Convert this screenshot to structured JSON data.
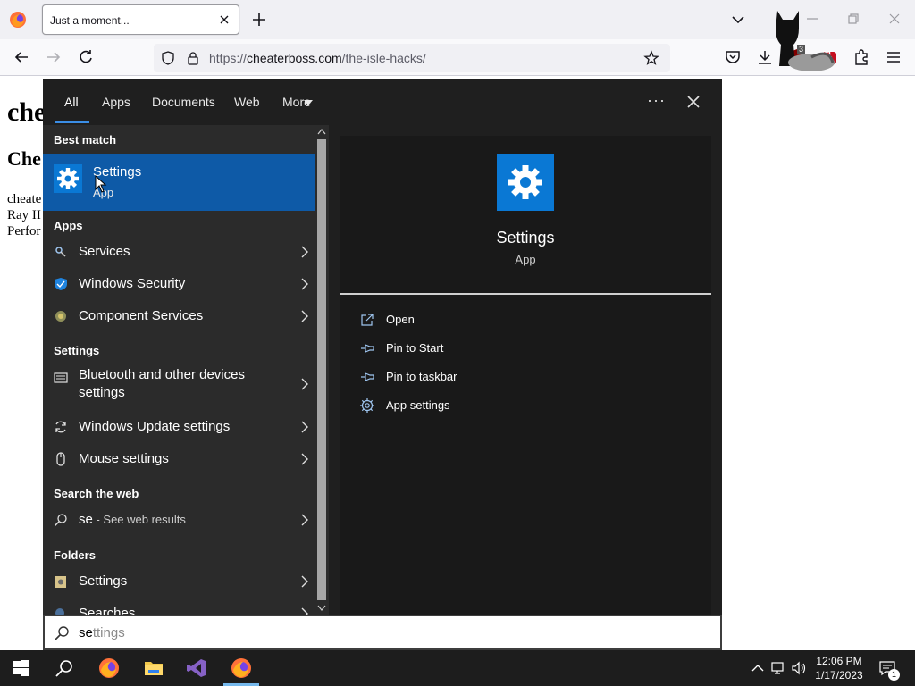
{
  "browser": {
    "tab_title": "Just a moment...",
    "url_prefix": "https://",
    "url_domain": "cheaterboss.com",
    "url_path": "/the-isle-hacks/",
    "ublock_count": "3",
    "ext_badge": "91"
  },
  "page": {
    "heading1": "che",
    "heading2": "Che",
    "line1": "cheate",
    "line2": "Ray II",
    "line3": "Perfor"
  },
  "search": {
    "filters": [
      "All",
      "Apps",
      "Documents",
      "Web",
      "More"
    ],
    "more_menu_icon": "ellipsis-icon",
    "sections": {
      "best_match": "Best match",
      "apps": "Apps",
      "settings": "Settings",
      "search_web": "Search the web",
      "folders": "Folders"
    },
    "best_match": {
      "title": "Settings",
      "subtitle": "App"
    },
    "apps": [
      {
        "label": "Services"
      },
      {
        "label": "Windows Security"
      },
      {
        "label": "Component Services"
      }
    ],
    "settings_results": [
      {
        "label_line1": "Bluetooth and other devices",
        "label_line2": "settings"
      },
      {
        "label": "Windows Update settings"
      },
      {
        "label": "Mouse settings"
      }
    ],
    "web_result": {
      "query": "se",
      "suffix": " - See web results"
    },
    "folders": [
      {
        "label": "Settings"
      },
      {
        "label": "Searches"
      }
    ],
    "detail": {
      "name": "Settings",
      "type": "App",
      "actions": [
        "Open",
        "Pin to Start",
        "Pin to taskbar",
        "App settings"
      ]
    },
    "query_typed": "se",
    "query_suggest": "ttings"
  },
  "taskbar": {
    "time": "12:06 PM",
    "date": "1/17/2023",
    "notification_count": "1"
  },
  "colors": {
    "accent": "#0a78d4",
    "selection": "#0e5aa7",
    "flyout_bg": "#1f1f1f"
  }
}
